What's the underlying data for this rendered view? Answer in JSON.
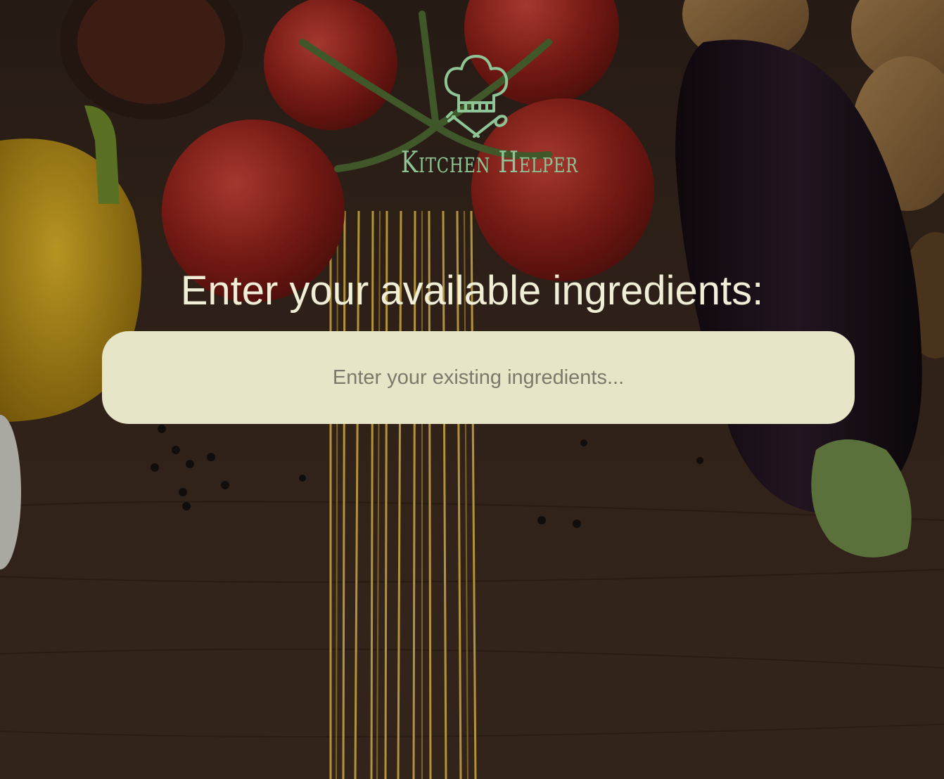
{
  "app": {
    "logo_icon": "chef-hat-utensils-icon",
    "brand_name": "Kitchen Helper"
  },
  "main": {
    "heading": "Enter your available ingredients:",
    "ingredient_input": {
      "value": "",
      "placeholder": "Enter your existing ingredients..."
    }
  },
  "colors": {
    "brand_green": "#8fc596",
    "heading_text": "#f0eed6",
    "input_background": "#e6e5c7"
  }
}
